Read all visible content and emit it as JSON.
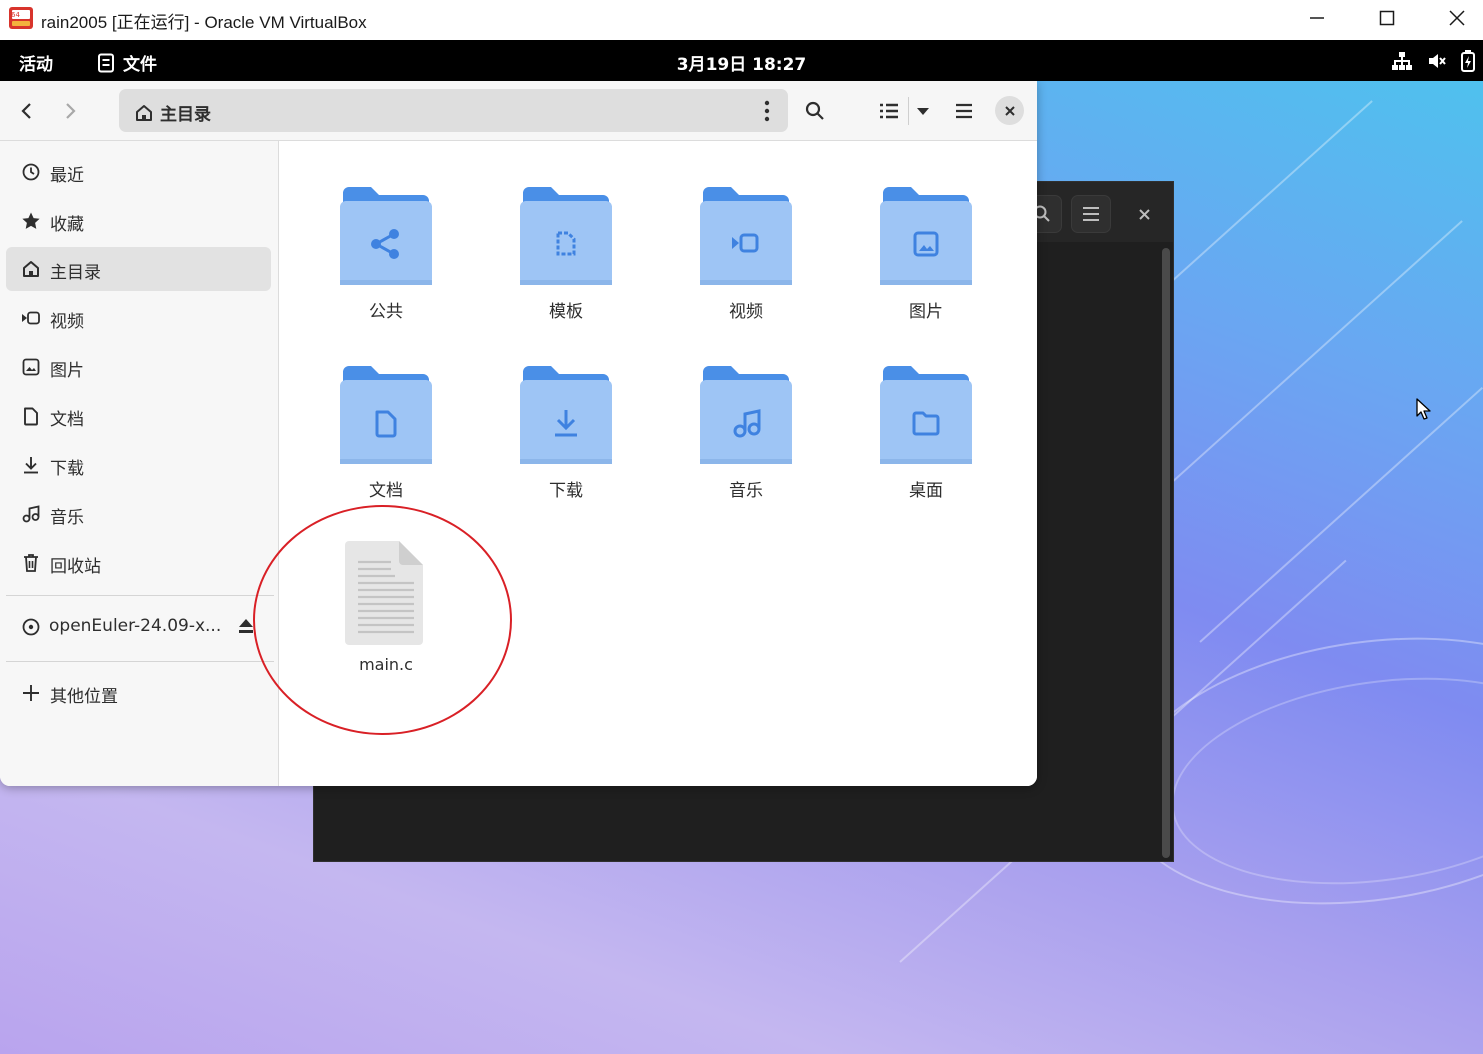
{
  "host_window": {
    "title": "rain2005 [正在运行] - Oracle VM VirtualBox",
    "app_icon": "virtualbox-icon",
    "controls": [
      "minimize-icon",
      "maximize-icon",
      "close-icon"
    ]
  },
  "topbar": {
    "activities": "活动",
    "app_name": "文件",
    "clock": "3月19日  18:27",
    "tray_icons": [
      "network-icon",
      "volume-muted-icon",
      "battery-icon"
    ]
  },
  "file_manager": {
    "location": "主目录",
    "nav": {
      "back_icon": "chevron-left-icon",
      "forward_icon": "chevron-right-icon"
    },
    "sidebar": {
      "items": [
        {
          "label": "最近",
          "icon": "clock-icon"
        },
        {
          "label": "收藏",
          "icon": "star-icon"
        },
        {
          "label": "主目录",
          "icon": "home-icon",
          "active": true
        },
        {
          "label": "视频",
          "icon": "video-icon"
        },
        {
          "label": "图片",
          "icon": "image-icon"
        },
        {
          "label": "文档",
          "icon": "document-icon"
        },
        {
          "label": "下载",
          "icon": "download-icon"
        },
        {
          "label": "音乐",
          "icon": "music-icon"
        },
        {
          "label": "回收站",
          "icon": "trash-icon"
        }
      ],
      "devices": [
        {
          "label": "openEuler-24.09-x...",
          "icon": "disc-icon",
          "action_icon": "eject-icon"
        }
      ],
      "other": {
        "label": "其他位置",
        "icon": "plus-icon"
      }
    },
    "files": [
      {
        "name": "公共",
        "icon": "share-icon",
        "type": "folder"
      },
      {
        "name": "模板",
        "icon": "template-icon",
        "type": "folder"
      },
      {
        "name": "视频",
        "icon": "video-icon",
        "type": "folder"
      },
      {
        "name": "图片",
        "icon": "image-icon",
        "type": "folder"
      },
      {
        "name": "文档",
        "icon": "document-icon",
        "type": "folder"
      },
      {
        "name": "下载",
        "icon": "download-icon",
        "type": "folder"
      },
      {
        "name": "音乐",
        "icon": "music-icon",
        "type": "folder"
      },
      {
        "name": "桌面",
        "icon": "folder-icon",
        "type": "folder"
      },
      {
        "name": "main.c",
        "icon": "text-file-icon",
        "type": "file"
      }
    ]
  },
  "colors": {
    "folder_back": "#4a8fe7",
    "folder_front": "#9ec5f5",
    "folder_glyph": "#3f82e0",
    "annotation": "#d92026",
    "terminal_bg": "#1f1f1f"
  }
}
